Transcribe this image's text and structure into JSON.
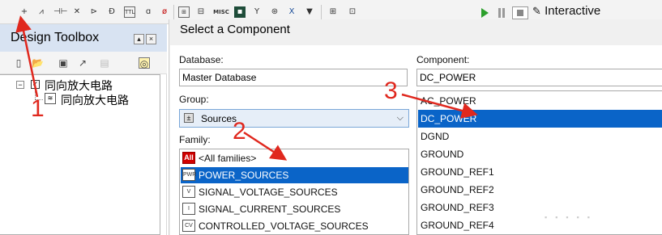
{
  "toolbar": {
    "icons": [
      "wire-icon",
      "resistor-icon",
      "capacitor-icon",
      "diode-icon",
      "transistor-icon",
      "gate-icon",
      "ttl-icon",
      "cmos-icon",
      "mcu-icon",
      "power-icon",
      "indicator-icon",
      "misc-icon",
      "rf-icon",
      "electromech-icon",
      "probe-icon",
      "connector-icon",
      "sheet-icon",
      "hierarchy-icon"
    ],
    "misc_label": "MISC",
    "mode_label": "Interactive"
  },
  "toolbox": {
    "title": "Design Toolbox",
    "tree": [
      {
        "label": "同向放大电路",
        "level": 0
      },
      {
        "label": "同向放大电路",
        "level": 1
      }
    ]
  },
  "dialog": {
    "title": "Select a Component",
    "database_label": "Database:",
    "database_value": "Master Database",
    "group_label": "Group:",
    "group_value": "Sources",
    "family_label": "Family:",
    "families": [
      {
        "label": "<All families>",
        "icon": "All",
        "selected": false
      },
      {
        "label": "POWER_SOURCES",
        "icon": "PWR",
        "selected": true
      },
      {
        "label": "SIGNAL_VOLTAGE_SOURCES",
        "icon": "V",
        "selected": false
      },
      {
        "label": "SIGNAL_CURRENT_SOURCES",
        "icon": "I",
        "selected": false
      },
      {
        "label": "CONTROLLED_VOLTAGE_SOURCES",
        "icon": "CV",
        "selected": false
      }
    ],
    "component_label": "Component:",
    "component_value": "DC_POWER",
    "components": [
      {
        "label": "AC_POWER",
        "selected": false
      },
      {
        "label": "DC_POWER",
        "selected": true
      },
      {
        "label": "DGND",
        "selected": false
      },
      {
        "label": "GROUND",
        "selected": false
      },
      {
        "label": "GROUND_REF1",
        "selected": false
      },
      {
        "label": "GROUND_REF2",
        "selected": false
      },
      {
        "label": "GROUND_REF3",
        "selected": false
      },
      {
        "label": "GROUND_REF4",
        "selected": false
      }
    ]
  },
  "annotations": {
    "step1": "1",
    "step2": "2",
    "step3": "3",
    "color": "#e0281e"
  }
}
